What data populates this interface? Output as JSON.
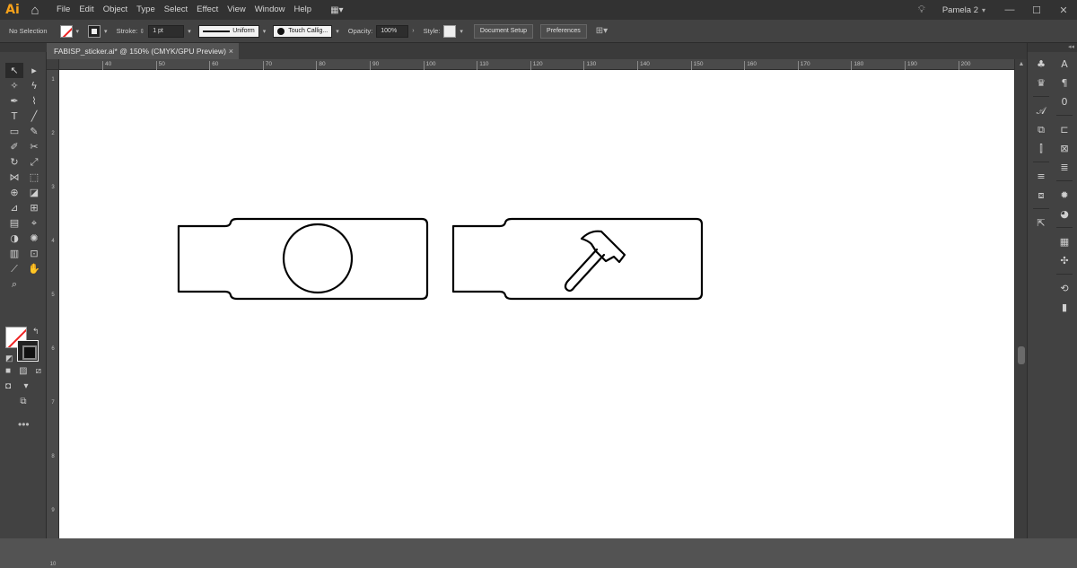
{
  "app": {
    "logo": "Ai",
    "home_icon": "home-icon"
  },
  "menu": {
    "items": [
      "File",
      "Edit",
      "Object",
      "Type",
      "Select",
      "Effect",
      "View",
      "Window",
      "Help"
    ],
    "workspace_icon": "workspace-grid-icon",
    "user": "Pamela 2",
    "bulb_icon": "lightbulb-icon"
  },
  "control": {
    "selection": "No Selection",
    "stroke_label": "Stroke:",
    "stroke_weight": "1 pt",
    "stroke_profile": "Uniform",
    "brush": "Touch Callig...",
    "opacity_label": "Opacity:",
    "opacity_value": "100%",
    "style_label": "Style:",
    "document_setup": "Document Setup",
    "preferences": "Preferences"
  },
  "document": {
    "tab_title": "FABISP_sticker.ai* @ 150% (CMYK/GPU Preview)",
    "close": "×"
  },
  "ruler": {
    "top": [
      "40",
      "50",
      "60",
      "70",
      "80",
      "90",
      "100",
      "110",
      "120",
      "130",
      "140",
      "150",
      "160",
      "170",
      "180",
      "190",
      "200"
    ],
    "left": [
      "1",
      "2",
      "3",
      "4",
      "5",
      "6",
      "7",
      "8",
      "9",
      "10"
    ]
  },
  "artwork": {
    "sticker_left_graphic": "circle",
    "sticker_right_graphic": "hammer-icon",
    "stroke_color": "#000000"
  },
  "colors": {
    "accent": "#f7a21a",
    "fill_none_slash": "#e22222"
  }
}
